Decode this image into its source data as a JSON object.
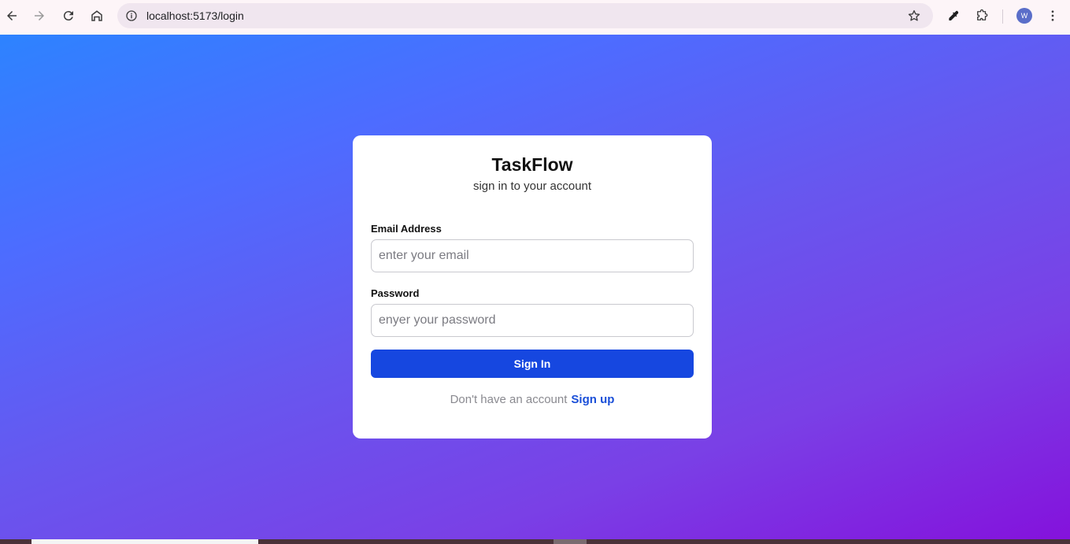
{
  "browser": {
    "url": "localhost:5173/login",
    "avatar_letter": "W",
    "icons": {
      "back": "arrow-left-icon",
      "forward": "arrow-right-icon",
      "reload": "reload-icon",
      "home": "home-icon",
      "site_info": "info-icon",
      "bookmark": "star-icon",
      "eyedropper": "eyedropper-icon",
      "extensions": "puzzle-icon",
      "menu": "kebab-menu-icon"
    }
  },
  "login": {
    "title": "TaskFlow",
    "subtitle": "sign in to your account",
    "email": {
      "label": "Email Address",
      "placeholder": "enter your email",
      "value": ""
    },
    "password": {
      "label": "Password",
      "placeholder": "enyer your password",
      "value": ""
    },
    "submit_label": "Sign In",
    "footer_text": "Don't have an account",
    "signup_link": "Sign up"
  },
  "colors": {
    "gradient_start": "#2d83ff",
    "gradient_end": "#8412dc",
    "primary_button": "#1647e0",
    "link": "#1a4fd8"
  }
}
